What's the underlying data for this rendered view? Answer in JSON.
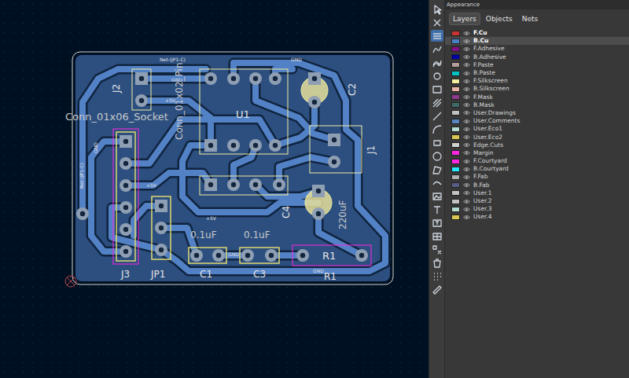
{
  "window": {
    "panel_title": "Appearance"
  },
  "tabs": [
    {
      "label": "Layers",
      "selected": true
    },
    {
      "label": "Objects",
      "selected": false
    },
    {
      "label": "Nets",
      "selected": false
    }
  ],
  "layers": [
    {
      "name": "F.Cu",
      "color": "#c83434",
      "visible": true,
      "active": true,
      "highlighted": false
    },
    {
      "name": "B.Cu",
      "color": "#4d7fc4",
      "visible": true,
      "active": true,
      "highlighted": true
    },
    {
      "name": "F.Adhesive",
      "color": "#841184",
      "visible": true,
      "active": false,
      "highlighted": false
    },
    {
      "name": "B.Adhesive",
      "color": "#0000a8",
      "visible": true,
      "active": false,
      "highlighted": false
    },
    {
      "name": "F.Paste",
      "color": "#b49c9c",
      "visible": true,
      "active": false,
      "highlighted": false
    },
    {
      "name": "B.Paste",
      "color": "#00c2c2",
      "visible": true,
      "active": false,
      "highlighted": false
    },
    {
      "name": "F.Silkscreen",
      "color": "#f2eda1",
      "visible": true,
      "active": false,
      "highlighted": false
    },
    {
      "name": "B.Silkscreen",
      "color": "#e8b2a7",
      "visible": true,
      "active": false,
      "highlighted": false
    },
    {
      "name": "F.Mask",
      "color": "#8e3a8e",
      "visible": true,
      "active": false,
      "highlighted": false
    },
    {
      "name": "B.Mask",
      "color": "#3e6a66",
      "visible": true,
      "active": false,
      "highlighted": false
    },
    {
      "name": "User.Drawings",
      "color": "#c2c2c2",
      "visible": true,
      "active": false,
      "highlighted": false
    },
    {
      "name": "User.Comments",
      "color": "#5984c1",
      "visible": true,
      "active": false,
      "highlighted": false
    },
    {
      "name": "User.Eco1",
      "color": "#b4dbd2",
      "visible": true,
      "active": false,
      "highlighted": false
    },
    {
      "name": "User.Eco2",
      "color": "#d8c852",
      "visible": true,
      "active": false,
      "highlighted": false
    },
    {
      "name": "Edge.Cuts",
      "color": "#d0d2cd",
      "visible": true,
      "active": false,
      "highlighted": false
    },
    {
      "name": "Margin",
      "color": "#ff26e2",
      "visible": true,
      "active": false,
      "highlighted": false
    },
    {
      "name": "F.Courtyard",
      "color": "#ff26e2",
      "visible": true,
      "active": false,
      "highlighted": false
    },
    {
      "name": "B.Courtyard",
      "color": "#26e9ff",
      "visible": true,
      "active": false,
      "highlighted": false
    },
    {
      "name": "F.Fab",
      "color": "#afafaf",
      "visible": true,
      "active": false,
      "highlighted": false
    },
    {
      "name": "B.Fab",
      "color": "#585d84",
      "visible": true,
      "active": false,
      "highlighted": false
    },
    {
      "name": "User.1",
      "color": "#c2c2c2",
      "visible": true,
      "active": false,
      "highlighted": false
    },
    {
      "name": "User.2",
      "color": "#c2c2c2",
      "visible": true,
      "active": false,
      "highlighted": false
    },
    {
      "name": "User.3",
      "color": "#b4dbd2",
      "visible": true,
      "active": false,
      "highlighted": false
    },
    {
      "name": "User.4",
      "color": "#d8c852",
      "visible": true,
      "active": false,
      "highlighted": false
    }
  ],
  "board_labels": [
    "Conn_01x06_Socket",
    "J2",
    "Conn_01x02_Pin",
    "Net-(JP1-C)",
    "GND",
    "GND",
    "+5V",
    "U1",
    "C2",
    "J1",
    "C4",
    "220uF",
    "0.1uF",
    "0.1uF",
    "C1",
    "C3",
    "R1",
    "R1",
    "J3",
    "JP1",
    "Net-(JP1-C)",
    "+5V",
    "GND",
    "GND",
    "GND",
    "+5V"
  ]
}
